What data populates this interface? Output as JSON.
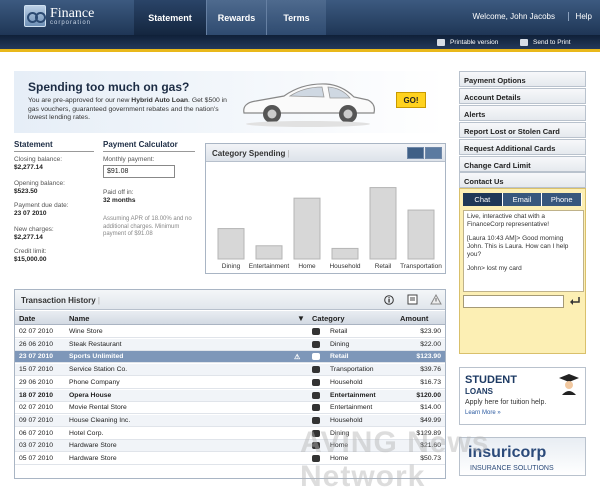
{
  "brand": {
    "name": "Finance",
    "sub": "corporation"
  },
  "nav": {
    "tabs": [
      "Statement",
      "Rewards",
      "Terms"
    ],
    "welcome": "Welcome, John Jacobs",
    "help": "Help"
  },
  "subnav": {
    "print": "Printable version",
    "send": "Send to Print"
  },
  "promo": {
    "title": "Spending too much on gas?",
    "body_pre": "You are pre-approved for our new ",
    "body_bold": "Hybrid Auto Loan",
    "body_post": ". Get $500 in gas vouchers, guaranteed government rebates and the nation's lowest lending rates.",
    "go": "GO!"
  },
  "statement": {
    "heading": "Statement",
    "closing_label": "Closing balance:",
    "closing": "$2,277.14",
    "opening_label": "Opening balance:",
    "opening": "$523.50",
    "due_label": "Payment due date:",
    "due": "23 07 2010",
    "charges_label": "New charges:",
    "charges": "$2,277.14",
    "limit_label": "Credit limit:",
    "limit": "$15,000.00"
  },
  "calculator": {
    "heading": "Payment Calculator",
    "monthly_label": "Monthly payment:",
    "monthly_value": "$91.08",
    "paid_label": "Paid off in:",
    "paid_value": "32 months",
    "note": "Assuming APR of 18.00% and no additional charges. Minimum payment of $91.08"
  },
  "chart_data": {
    "type": "bar",
    "title": "Category Spending",
    "categories": [
      "Dining",
      "Entertainment",
      "Home",
      "Household",
      "Retail",
      "Transportation"
    ],
    "values": [
      230,
      100,
      460,
      80,
      540,
      370
    ],
    "ylim": [
      0,
      620
    ],
    "grid": false,
    "bar_color": "#d7d7d7"
  },
  "transactions": {
    "title": "Transaction History",
    "columns": {
      "date": "Date",
      "name": "Name",
      "category": "Category",
      "amount": "Amount"
    },
    "rows": [
      {
        "date": "02 07 2010",
        "name": "Wine Store",
        "category": "Retail",
        "amount": "$23.90"
      },
      {
        "date": "26 06 2010",
        "name": "Steak Restaurant",
        "category": "Dining",
        "amount": "$22.00"
      },
      {
        "date": "23 07 2010",
        "name": "Sports Unlimited",
        "category": "Retail",
        "amount": "$123.90"
      },
      {
        "date": "15 07 2010",
        "name": "Service Station Co.",
        "category": "Transportation",
        "amount": "$39.76"
      },
      {
        "date": "29 06 2010",
        "name": "Phone Company",
        "category": "Household",
        "amount": "$16.73"
      },
      {
        "date": "18 07 2010",
        "name": "Opera House",
        "category": "Entertainment",
        "amount": "$120.00"
      },
      {
        "date": "02 07 2010",
        "name": "Movie Rental Store",
        "category": "Entertainment",
        "amount": "$14.00"
      },
      {
        "date": "09 07 2010",
        "name": "House Cleaning Inc.",
        "category": "Household",
        "amount": "$49.99"
      },
      {
        "date": "06 07 2010",
        "name": "Hotel Corp.",
        "category": "Dining",
        "amount": "$129.89"
      },
      {
        "date": "03 07 2010",
        "name": "Hardware Store",
        "category": "Home",
        "amount": "$21.60"
      },
      {
        "date": "05 07 2010",
        "name": "Hardware Store",
        "category": "Home",
        "amount": "$50.73"
      }
    ]
  },
  "sidebar": {
    "items": [
      "Payment Options",
      "Account Details",
      "Alerts",
      "Report Lost or Stolen Card",
      "Request Additional Cards",
      "Change Card Limit",
      "Contact Us"
    ]
  },
  "chat": {
    "tabs": [
      "Chat",
      "Email",
      "Phone"
    ],
    "line1": "Live, interactive chat with a FinanceCorp representative!",
    "line2": "[Laura 10:43 AM]> Good morning John.  This is Laura.  How can I help you?",
    "line3": "John> lost my card"
  },
  "ads": {
    "student_title": "STUDENT",
    "student_sub": "LOANS",
    "student_tag": "Apply here for tuition help.",
    "learn": "Learn More »",
    "insurance_name": "insuricorp",
    "insurance_sub": "INSURANCE SOLUTIONS"
  },
  "watermark": "AVING News Network"
}
